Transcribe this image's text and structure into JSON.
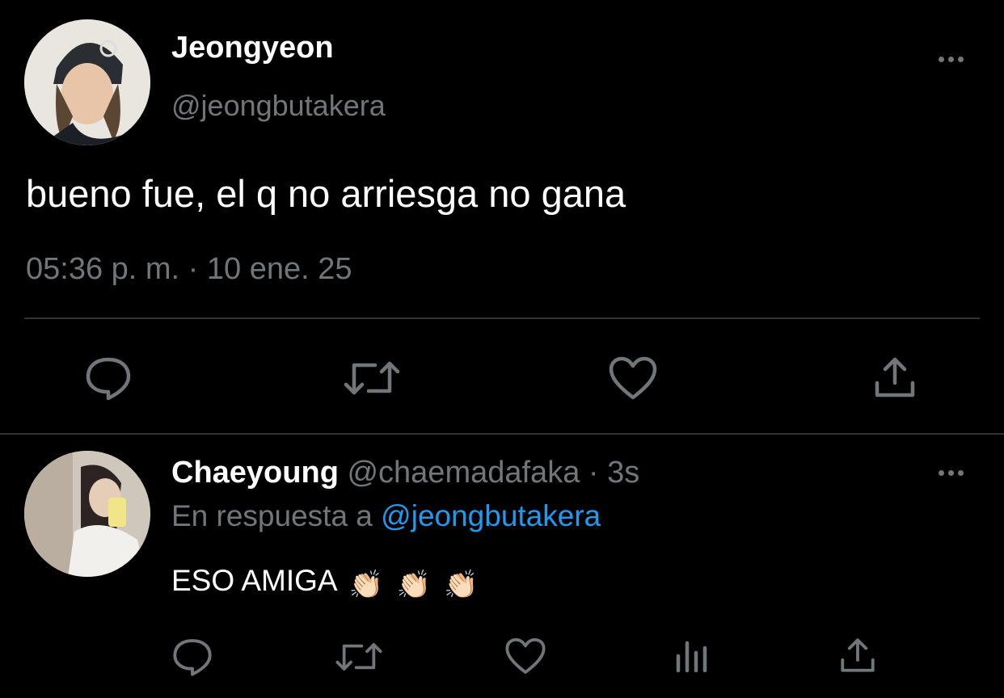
{
  "main_tweet": {
    "author_name": "Jeongyeon",
    "author_handle": "@jeongbutakera",
    "text": "bueno fue, el q no arriesga no gana",
    "timestamp": "05:36 p. m. · 10 ene. 25",
    "actions": [
      "reply-icon",
      "retweet-icon",
      "like-icon",
      "share-icon"
    ]
  },
  "reply": {
    "author_name": "Chaeyoung",
    "author_handle": "@chaemadafaka",
    "time_ago": "· 3s",
    "reply_to_prefix": "En respuesta a",
    "reply_to_handle": "@jeongbutakera",
    "text": "ESO AMIGA",
    "emoji": [
      "👏🏻",
      "👏🏻",
      "👏🏻"
    ],
    "actions": [
      "reply-icon",
      "retweet-icon",
      "like-icon",
      "analytics-icon",
      "share-icon"
    ]
  },
  "colors": {
    "background": "#000000",
    "text": "#e7e9ea",
    "muted": "#71767b",
    "link": "#1d9bf0",
    "divider": "#2f3336"
  }
}
